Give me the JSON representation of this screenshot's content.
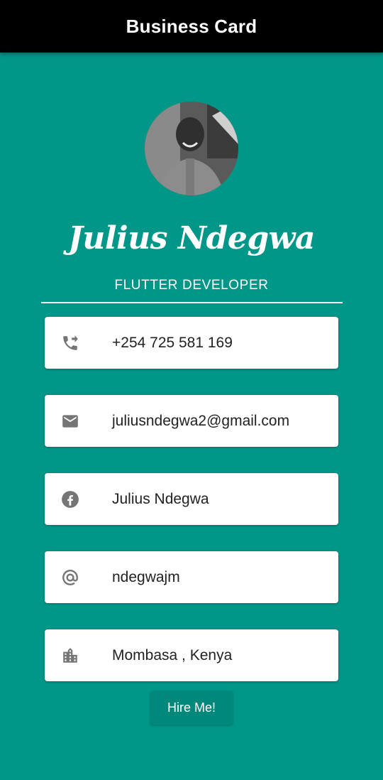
{
  "app_bar": {
    "title": "Business Card"
  },
  "profile": {
    "name": "Julius Ndegwa",
    "role": "FLUTTER DEVELOPER"
  },
  "contacts": [
    {
      "icon": "phone-forwarded-icon",
      "text": "+254 725 581 169"
    },
    {
      "icon": "email-icon",
      "text": "juliusndegwa2@gmail.com"
    },
    {
      "icon": "facebook-icon",
      "text": "Julius Ndegwa"
    },
    {
      "icon": "at-sign-icon",
      "text": "ndegwajm"
    },
    {
      "icon": "location-city-icon",
      "text": "Mombasa , Kenya"
    }
  ],
  "hire_button": {
    "label": "Hire Me!"
  },
  "colors": {
    "background": "#009688",
    "app_bar": "#000000",
    "card": "#ffffff",
    "icon": "#757575",
    "button": "#00897b"
  }
}
